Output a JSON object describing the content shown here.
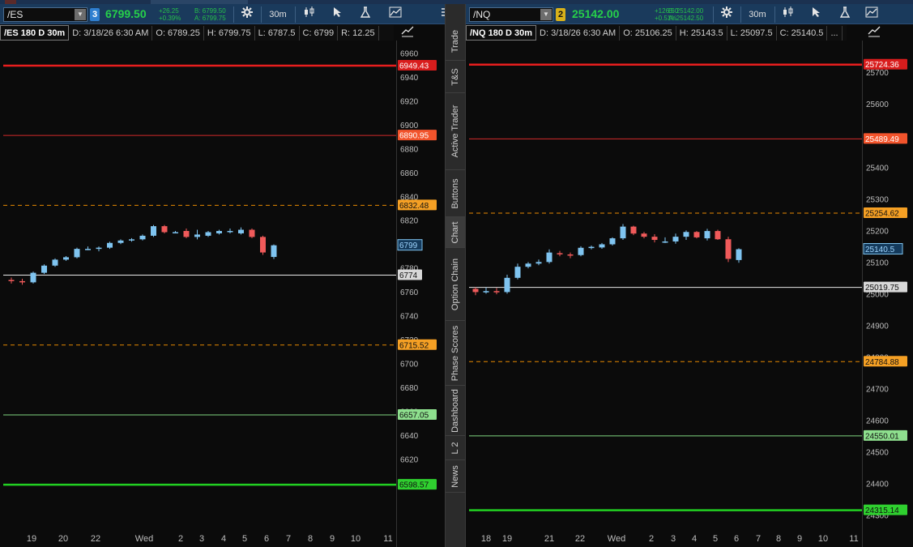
{
  "colors": {
    "up_candle": "#7fc4f0",
    "down_candle": "#f05a5a",
    "neutral_line": "#ffffff",
    "red_line": "#e02020",
    "orange_line": "#e88a00",
    "green_line": "#2fd02f",
    "toolbar_bg": "#1a3a5c"
  },
  "sidebar": {
    "tabs": [
      {
        "label": "Trade",
        "active": false
      },
      {
        "label": "T&S",
        "active": false
      },
      {
        "label": "Active Trader",
        "active": false
      },
      {
        "label": "Buttons",
        "active": false
      },
      {
        "label": "Chart",
        "active": true
      },
      {
        "label": "Option Chain",
        "active": false
      },
      {
        "label": "Phase Scores",
        "active": false
      },
      {
        "label": "Dashboard",
        "active": false
      },
      {
        "label": "L 2",
        "active": false
      },
      {
        "label": "News",
        "active": false
      }
    ]
  },
  "panels": [
    {
      "id": "es",
      "toolbar": {
        "symbol": "/ES",
        "link_badge": "3",
        "link_color": "#2f7fd0",
        "last_price": "6799.50",
        "change": "+26.25",
        "change_pct": "+0.39%",
        "bid": "B: 6799.50",
        "ask": "A: 6799.75",
        "timeframe": "30m",
        "icons": [
          "gear-icon",
          "candles-style-icon",
          "cursor-icon",
          "flask-icon",
          "drawing-icon",
          "menu-icon"
        ]
      },
      "info": {
        "title": "/ES 180 D 30m",
        "date": "D: 3/18/26 6:30 AM",
        "open": "O: 6789.25",
        "high": "H: 6799.75",
        "low": "L: 6787.5",
        "close": "C: 6799",
        "range": "R: 12.25"
      },
      "chart_data": {
        "type": "candlestick",
        "ylim": [
          6560,
          6965
        ],
        "y_ticks": [
          6960,
          6940,
          6920,
          6900,
          6880,
          6860,
          6840,
          6820,
          6800,
          6780,
          6760,
          6740,
          6720,
          6700,
          6680,
          6660,
          6640,
          6620,
          6600
        ],
        "x_ticks": [
          "19",
          "20",
          "22",
          "Wed",
          "2",
          "3",
          "4",
          "5",
          "6",
          "7",
          "8",
          "9",
          "10",
          "11"
        ],
        "levels": [
          {
            "value": 6949.43,
            "label": "6949.43",
            "style": "red_thick"
          },
          {
            "value": 6890.95,
            "label": "6890.95",
            "style": "red_thin"
          },
          {
            "value": 6832.48,
            "label": "6832.48",
            "style": "orange_dashed"
          },
          {
            "value": 6774,
            "label": "6774",
            "style": "white"
          },
          {
            "value": 6715.52,
            "label": "6715.52",
            "style": "orange_dashed"
          },
          {
            "value": 6657.05,
            "label": "6657.05",
            "style": "green_thin"
          },
          {
            "value": 6598.57,
            "label": "6598.57",
            "style": "green_thick"
          }
        ],
        "last_marker": {
          "value": 6799,
          "label": "6799"
        },
        "candles": [
          {
            "o": 6770,
            "h": 6772,
            "l": 6767,
            "c": 6769
          },
          {
            "o": 6769,
            "h": 6771,
            "l": 6766,
            "c": 6768
          },
          {
            "o": 6768,
            "h": 6777,
            "l": 6767,
            "c": 6776
          },
          {
            "o": 6776,
            "h": 6783,
            "l": 6775,
            "c": 6782
          },
          {
            "o": 6782,
            "h": 6788,
            "l": 6781,
            "c": 6787
          },
          {
            "o": 6787,
            "h": 6790,
            "l": 6786,
            "c": 6789
          },
          {
            "o": 6789,
            "h": 6797,
            "l": 6788,
            "c": 6796
          },
          {
            "o": 6796,
            "h": 6798,
            "l": 6795,
            "c": 6796
          },
          {
            "o": 6796,
            "h": 6798,
            "l": 6794,
            "c": 6797
          },
          {
            "o": 6797,
            "h": 6802,
            "l": 6796,
            "c": 6801
          },
          {
            "o": 6801,
            "h": 6804,
            "l": 6800,
            "c": 6803
          },
          {
            "o": 6803,
            "h": 6805,
            "l": 6802,
            "c": 6804
          },
          {
            "o": 6804,
            "h": 6808,
            "l": 6803,
            "c": 6807
          },
          {
            "o": 6807,
            "h": 6816,
            "l": 6806,
            "c": 6815
          },
          {
            "o": 6815,
            "h": 6816,
            "l": 6809,
            "c": 6810
          },
          {
            "o": 6810,
            "h": 6811,
            "l": 6809,
            "c": 6810
          },
          {
            "o": 6811,
            "h": 6813,
            "l": 6805,
            "c": 6806
          },
          {
            "o": 6806,
            "h": 6812,
            "l": 6804,
            "c": 6808
          },
          {
            "o": 6807,
            "h": 6811,
            "l": 6806,
            "c": 6810
          },
          {
            "o": 6809,
            "h": 6812,
            "l": 6808,
            "c": 6811
          },
          {
            "o": 6810,
            "h": 6813,
            "l": 6809,
            "c": 6811
          },
          {
            "o": 6809,
            "h": 6814,
            "l": 6808,
            "c": 6812
          },
          {
            "o": 6812,
            "h": 6813,
            "l": 6805,
            "c": 6806
          },
          {
            "o": 6806,
            "h": 6807,
            "l": 6791,
            "c": 6793
          },
          {
            "o": 6789.25,
            "h": 6799.75,
            "l": 6787.5,
            "c": 6799
          }
        ]
      }
    },
    {
      "id": "nq",
      "toolbar": {
        "symbol": "/NQ",
        "link_badge": "2",
        "link_color": "#d8b11a",
        "last_price": "25142.00",
        "change": "+126.50",
        "change_pct": "+0.51%",
        "bid": "B: 25142.00",
        "ask": "A: 25142.50",
        "timeframe": "30m",
        "icons": [
          "gear-icon",
          "candles-style-icon",
          "cursor-icon",
          "flask-icon",
          "drawing-icon"
        ]
      },
      "info": {
        "title": "/NQ 180 D 30m",
        "date": "D: 3/18/26 6:30 AM",
        "open": "O: 25106.25",
        "high": "H: 25143.5",
        "low": "L: 25097.5",
        "close": "C: 25140.5",
        "range": "..."
      },
      "chart_data": {
        "type": "candlestick",
        "ylim": [
          24250,
          25780
        ],
        "y_ticks": [
          25700,
          25600,
          25500,
          25400,
          25300,
          25200,
          25100,
          25000,
          24900,
          24800,
          24700,
          24600,
          24500,
          24400,
          24300
        ],
        "x_ticks": [
          "18",
          "19",
          "21",
          "22",
          "Wed",
          "2",
          "3",
          "4",
          "5",
          "6",
          "7",
          "8",
          "9",
          "10",
          "11"
        ],
        "levels": [
          {
            "value": 25724.36,
            "label": "25724.36",
            "style": "red_thick"
          },
          {
            "value": 25489.49,
            "label": "25489.49",
            "style": "red_thin"
          },
          {
            "value": 25254.62,
            "label": "25254.62",
            "style": "orange_dashed"
          },
          {
            "value": 25019.75,
            "label": "25019.75",
            "style": "white"
          },
          {
            "value": 24784.88,
            "label": "24784.88",
            "style": "orange_dashed"
          },
          {
            "value": 24550.01,
            "label": "24550.01",
            "style": "green_thin"
          },
          {
            "value": 24315.14,
            "label": "24315.14",
            "style": "green_thick"
          }
        ],
        "last_marker": {
          "value": 25140.5,
          "label": "25140.5"
        },
        "candles": [
          {
            "o": 25015,
            "h": 25020,
            "l": 24995,
            "c": 25005
          },
          {
            "o": 25004,
            "h": 25020,
            "l": 25000,
            "c": 25008
          },
          {
            "o": 25008,
            "h": 25018,
            "l": 24998,
            "c": 25005
          },
          {
            "o": 25005,
            "h": 25060,
            "l": 25000,
            "c": 25050
          },
          {
            "o": 25050,
            "h": 25095,
            "l": 25045,
            "c": 25085
          },
          {
            "o": 25085,
            "h": 25100,
            "l": 25080,
            "c": 25095
          },
          {
            "o": 25095,
            "h": 25108,
            "l": 25090,
            "c": 25100
          },
          {
            "o": 25100,
            "h": 25140,
            "l": 25095,
            "c": 25130
          },
          {
            "o": 25128,
            "h": 25135,
            "l": 25118,
            "c": 25125
          },
          {
            "o": 25124,
            "h": 25130,
            "l": 25112,
            "c": 25122
          },
          {
            "o": 25122,
            "h": 25150,
            "l": 25118,
            "c": 25145
          },
          {
            "o": 25145,
            "h": 25152,
            "l": 25140,
            "c": 25148
          },
          {
            "o": 25146,
            "h": 25160,
            "l": 25142,
            "c": 25156
          },
          {
            "o": 25156,
            "h": 25178,
            "l": 25152,
            "c": 25175
          },
          {
            "o": 25175,
            "h": 25220,
            "l": 25170,
            "c": 25212
          },
          {
            "o": 25212,
            "h": 25215,
            "l": 25185,
            "c": 25190
          },
          {
            "o": 25190,
            "h": 25195,
            "l": 25175,
            "c": 25180
          },
          {
            "o": 25180,
            "h": 25188,
            "l": 25162,
            "c": 25170
          },
          {
            "o": 25165,
            "h": 25178,
            "l": 25160,
            "c": 25165
          },
          {
            "o": 25165,
            "h": 25190,
            "l": 25158,
            "c": 25180
          },
          {
            "o": 25180,
            "h": 25200,
            "l": 25170,
            "c": 25195
          },
          {
            "o": 25195,
            "h": 25198,
            "l": 25175,
            "c": 25178
          },
          {
            "o": 25175,
            "h": 25205,
            "l": 25168,
            "c": 25198
          },
          {
            "o": 25198,
            "h": 25202,
            "l": 25170,
            "c": 25172
          },
          {
            "o": 25172,
            "h": 25180,
            "l": 25100,
            "c": 25110
          },
          {
            "o": 25106.25,
            "h": 25143.5,
            "l": 25097.5,
            "c": 25140.5
          }
        ]
      }
    }
  ]
}
